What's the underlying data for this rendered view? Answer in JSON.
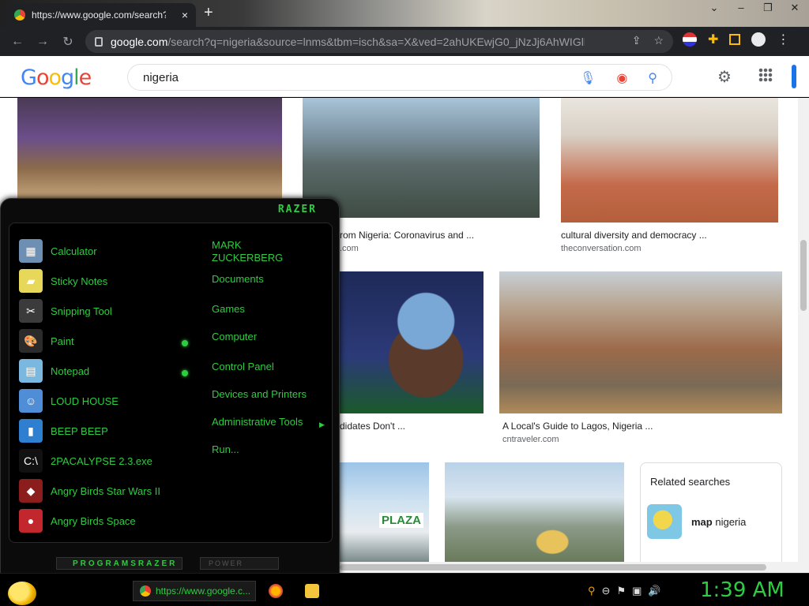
{
  "browser": {
    "tab_title": "https://www.google.com/search?q=nigeria",
    "tab_close": "×",
    "new_tab": "+",
    "window_controls": [
      "⌄",
      "–",
      "❐",
      "✕"
    ],
    "url_domain": "google.com",
    "url_path": "/search?q=nigeria&source=lnms&tbm=isch&sa=X&ved=2ahUKEwjG0_jNzJj6AhWIGlkFH...",
    "nav": [
      "←",
      "→",
      "↻"
    ]
  },
  "google": {
    "logo": [
      "G",
      "o",
      "o",
      "g",
      "l",
      "e"
    ],
    "logo_colors": [
      "#4285F4",
      "#EA4335",
      "#FBBC05",
      "#4285F4",
      "#34A853",
      "#EA4335"
    ],
    "query": "nigeria"
  },
  "results": [
    {
      "caption": "rom Nigeria: Coronavirus and ...",
      "site": ".com"
    },
    {
      "caption": "cultural diversity and democracy ...",
      "site": "theconversation.com"
    },
    {
      "caption": "didates Don't ...",
      "site": ""
    },
    {
      "caption": "A Local's Guide to Lagos, Nigeria ...",
      "site": "cntraveler.com"
    }
  ],
  "plaza_sign": "PLAZA",
  "related": {
    "title": "Related searches",
    "item_bold": "map",
    "item_rest": " nigeria"
  },
  "startmenu": {
    "brand": "RAZER",
    "programs": [
      {
        "label": "Calculator",
        "icon": "calculator-icon",
        "glyph": "▦",
        "bg": "#6d8fb3"
      },
      {
        "label": "Sticky Notes",
        "icon": "sticky-notes-icon",
        "glyph": "▰",
        "bg": "#e8d85a"
      },
      {
        "label": "Snipping Tool",
        "icon": "snipping-tool-icon",
        "glyph": "✂",
        "bg": "#3b3b3b"
      },
      {
        "label": "Paint",
        "icon": "paint-icon",
        "glyph": "🎨",
        "bg": "#2b2b2b"
      },
      {
        "label": "Notepad",
        "icon": "notepad-icon",
        "glyph": "▤",
        "bg": "#7ab8e0"
      },
      {
        "label": "LOUD HOUSE",
        "icon": "loud-house-icon",
        "glyph": "☺",
        "bg": "#4f8ed6"
      },
      {
        "label": "BEEP BEEP",
        "icon": "beep-beep-icon",
        "glyph": "▮",
        "bg": "#2f7fd1"
      },
      {
        "label": "2PACALYPSE 2.3.exe",
        "icon": "console-icon",
        "glyph": "C:\\",
        "bg": "#111"
      },
      {
        "label": "Angry Birds Star Wars II",
        "icon": "angry-birds-star-wars-icon",
        "glyph": "◆",
        "bg": "#8b1d1d"
      },
      {
        "label": "Angry Birds Space",
        "icon": "angry-birds-space-icon",
        "glyph": "●",
        "bg": "#c2272d"
      }
    ],
    "links": [
      "MARK ZUCKERBERG",
      "Documents",
      "Games",
      "Computer",
      "Control Panel",
      "Devices and Printers",
      "Administrative Tools",
      "Run..."
    ],
    "programs_button": "PROGRAMS",
    "programs_brand": "RAZER",
    "power_button": "POWER"
  },
  "taskbar": {
    "chrome_item": "https://www.google.c...",
    "clock": "1:39 AM",
    "tray": [
      "⚲",
      "⊖",
      "⚑",
      "▣",
      "🔊"
    ]
  }
}
